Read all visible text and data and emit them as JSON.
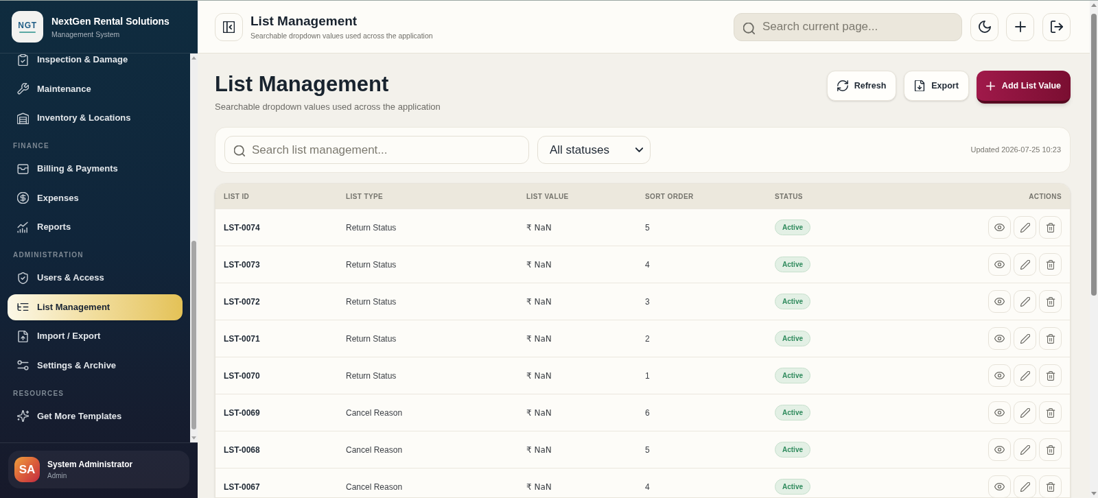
{
  "sidebar": {
    "brand": {
      "logo_text": "NGT",
      "title": "NextGen Rental Solutions",
      "subtitle": "Management System"
    },
    "sections": [
      {
        "items": [
          {
            "label": "Inspection & Damage",
            "selected": false
          },
          {
            "label": "Maintenance",
            "selected": false
          },
          {
            "label": "Inventory & Locations",
            "selected": false
          }
        ]
      },
      {
        "label": "FINANCE",
        "items": [
          {
            "label": "Billing & Payments",
            "selected": false
          },
          {
            "label": "Expenses",
            "selected": false
          },
          {
            "label": "Reports",
            "selected": false
          }
        ]
      },
      {
        "label": "ADMINISTRATION",
        "items": [
          {
            "label": "Users & Access",
            "selected": false
          },
          {
            "label": "List Management",
            "selected": true
          },
          {
            "label": "Import / Export",
            "selected": false
          },
          {
            "label": "Settings & Archive",
            "selected": false
          }
        ]
      },
      {
        "label": "RESOURCES",
        "items": [
          {
            "label": "Get More Templates",
            "selected": false
          }
        ]
      }
    ],
    "user": {
      "initials": "SA",
      "name": "System Administrator",
      "role": "Admin"
    }
  },
  "header": {
    "title": "List Management",
    "subtitle": "Searchable dropdown values used across the application",
    "search": {
      "placeholder": "Search current page..."
    }
  },
  "page": {
    "title": "List Management",
    "subtitle": "Searchable dropdown values used across the application",
    "actions": [
      {
        "label": "Refresh",
        "kind": "secondary"
      },
      {
        "label": "Export",
        "kind": "secondary"
      },
      {
        "label": "Add List Value",
        "kind": "primary"
      }
    ]
  },
  "filters": {
    "search": {
      "placeholder": "Search list management..."
    },
    "status_select": {
      "value": "All statuses"
    },
    "updated": "Updated 2026-07-25 10:23"
  },
  "table": {
    "columns": [
      "LIST ID",
      "LIST TYPE",
      "LIST VALUE",
      "SORT ORDER",
      "STATUS",
      "ACTIONS"
    ],
    "rows": [
      {
        "list_id": "LST-0074",
        "list_type": "Return Status",
        "list_value": "₹ NaN",
        "sort_order": "5",
        "status": "Active"
      },
      {
        "list_id": "LST-0073",
        "list_type": "Return Status",
        "list_value": "₹ NaN",
        "sort_order": "4",
        "status": "Active"
      },
      {
        "list_id": "LST-0072",
        "list_type": "Return Status",
        "list_value": "₹ NaN",
        "sort_order": "3",
        "status": "Active"
      },
      {
        "list_id": "LST-0071",
        "list_type": "Return Status",
        "list_value": "₹ NaN",
        "sort_order": "2",
        "status": "Active"
      },
      {
        "list_id": "LST-0070",
        "list_type": "Return Status",
        "list_value": "₹ NaN",
        "sort_order": "1",
        "status": "Active"
      },
      {
        "list_id": "LST-0069",
        "list_type": "Cancel Reason",
        "list_value": "₹ NaN",
        "sort_order": "6",
        "status": "Active"
      },
      {
        "list_id": "LST-0068",
        "list_type": "Cancel Reason",
        "list_value": "₹ NaN",
        "sort_order": "5",
        "status": "Active"
      },
      {
        "list_id": "LST-0067",
        "list_type": "Cancel Reason",
        "list_value": "₹ NaN",
        "sort_order": "4",
        "status": "Active"
      }
    ]
  }
}
